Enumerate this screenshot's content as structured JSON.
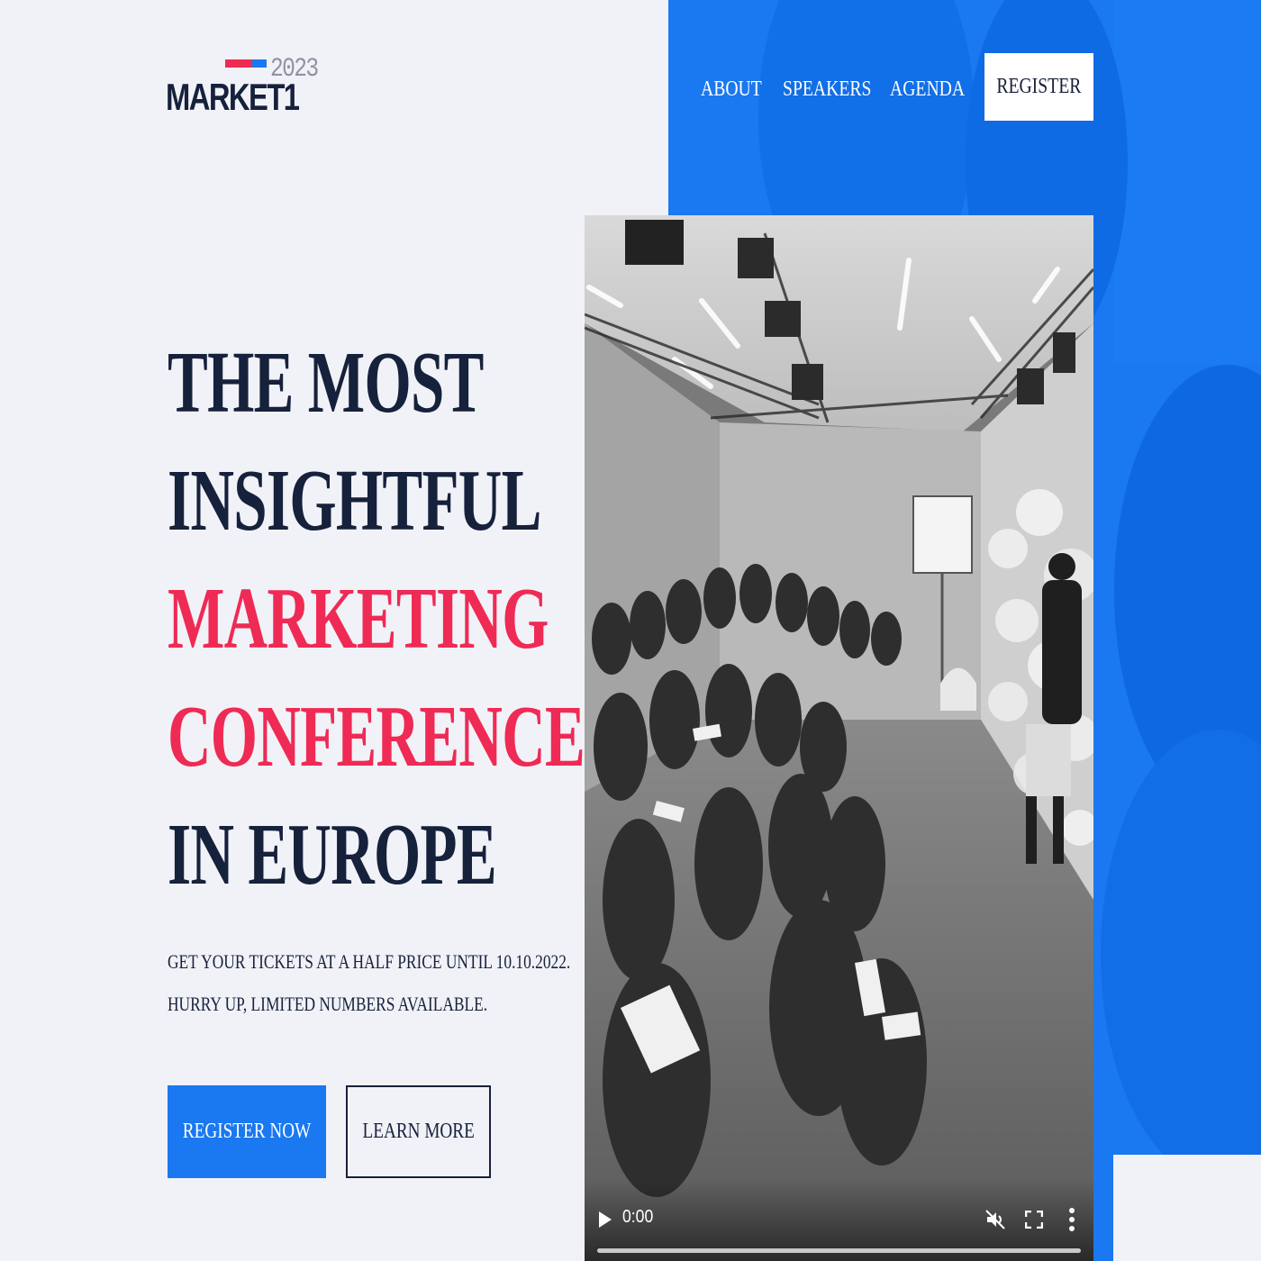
{
  "brand": {
    "name": "MARKET1",
    "year": "2023"
  },
  "nav": {
    "items": [
      {
        "label": "ABOUT"
      },
      {
        "label": "SPEAKERS"
      },
      {
        "label": "AGENDA"
      }
    ],
    "register_label": "REGISTER"
  },
  "hero": {
    "headline": {
      "line1": "THE MOST",
      "line2": "INSIGHTFUL",
      "line3": "MARKETING",
      "line4": "CONFERENCE",
      "line5": "IN EUROPE"
    },
    "promo": {
      "line1": "GET YOUR TICKETS AT A HALF PRICE UNTIL 10.10.2022.",
      "line2": "HURRY UP, LIMITED NUMBERS AVAILABLE."
    },
    "primary_button": "REGISTER NOW",
    "secondary_button": "LEARN MORE"
  },
  "video": {
    "time": "0:00",
    "progress": 0,
    "icons": [
      "play-icon",
      "mute-icon",
      "fullscreen-icon",
      "more-options-icon"
    ]
  },
  "colors": {
    "accent_blue": "#1a78f0",
    "accent_red": "#ef2a55",
    "text_dark": "#16213b",
    "background": "#f1f2f8"
  }
}
